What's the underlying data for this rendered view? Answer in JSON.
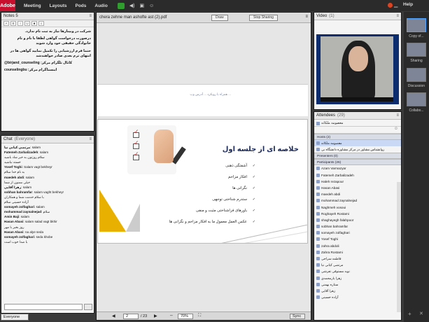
{
  "app": {
    "logo_text": "Adobe",
    "menus": [
      "Meeting",
      "Layouts",
      "Pods",
      "Audio"
    ],
    "help": "Help"
  },
  "notes": {
    "title": "Notes 5",
    "paragraphs": [
      "شرکت در وبینارها نیاز به ثبت نام ندارد.",
      "درصورت درخواست گواهی لطفا با نام و نام خانوادگی حقیقی خود وارد شوید",
      "حتما فرم ارزشیابی را تکمیل نمایید گواهی ها در انتهای ترم بعدی صادر خواهندشد",
      "@birjand_counseling :کانال تلگرام مرکز",
      "counselingbu :اینستاگرام مرکز"
    ]
  },
  "chat": {
    "title": "Chat",
    "audience": "(Everyone)",
    "tab": "Everyone",
    "messages": [
      {
        "name": "مرتضی کیانی نیا",
        "text": "salam"
      },
      {
        "name": "Fatemeh Zarbalizadeh",
        "text": "salam"
      },
      {
        "name": "",
        "text": "سلام روزتون به خیر شاد باشید"
      },
      {
        "name": "",
        "text": "خسته نباشید"
      },
      {
        "name": "Yosef Toghi",
        "text": "Salam vagt bekheyr"
      },
      {
        "name": "",
        "text": "به نام خدا سلام"
      },
      {
        "name": "maedeh abdi",
        "text": "salam"
      },
      {
        "name": "",
        "text": "خیلی ممنون از شما"
      },
      {
        "name": "زهرا آقایی",
        "text": "salam"
      },
      {
        "name": "sobhan bahramfar",
        "text": "salam vaght bekheyr"
      },
      {
        "name": "",
        "text": "با سلام خدمت شما و همکاران"
      },
      {
        "name": "",
        "text": "آزاده حسینی سلام"
      },
      {
        "name": "somayeh zolfaghari",
        "text": "salam"
      },
      {
        "name": "mohammad zaynalnejad",
        "text": "سلام"
      },
      {
        "name": "Amin Baji",
        "text": "salam"
      },
      {
        "name": "Hasan Abasi",
        "text": "salam salad vagt bkhir"
      },
      {
        "name": "",
        "text": "روز بخیر با مهر"
      },
      {
        "name": "Hasan Abasi",
        "text": "na alye seda"
      },
      {
        "name": "somayeh zolfaghari",
        "text": "seda khobe"
      },
      {
        "name": "",
        "text": "با صدا خوب است"
      }
    ]
  },
  "share": {
    "title": "chera zehne man ashofte ast (2).pdf",
    "draw_btn": "Draw",
    "stop_btn": "Stop Sharing",
    "top_slide_text": "... همراه با رویکرد ... آدرس وب",
    "slide": {
      "title": "خلاصه ای از جلسه اول",
      "bullets": [
        "آشفتگی ذهنی",
        "افکار مزاحم",
        "نگرانی ها",
        "ستدرم شناختی توجهی",
        "باورهای فراشناختی مثبت و منفی",
        "عکس العمل معمول ما به افکار مزاحم و نگرانی ها"
      ]
    },
    "page_current": "2",
    "page_total": "/ 23",
    "zoom": "70%",
    "sync": "Sync"
  },
  "video": {
    "title": "Video",
    "count": "(1)"
  },
  "attendees": {
    "title": "Attendees",
    "count": "(29)",
    "host_self": "معصومه ملکانه",
    "hosts_label": "Hosts (2)",
    "hosts": [
      "معصومه ملکانه",
      "روانشناس مشاور در مرکز مشاوره دانشگاه بی"
    ],
    "presenters_label": "Presenters (0)",
    "participants_label": "Participants (26)",
    "participants": [
      "Azam Varmazyar",
      "Fatemeh Zarbalizadeh",
      "Haleh rezapour",
      "Hasan Abasi",
      "maedeh abdi",
      "mohammad zaynalnejad",
      "Naghmeh vosoui",
      "Roghayeh Rostami",
      "shaghayegh falahpoor",
      "sobhan bahramfar",
      "somayeh zolfaghari",
      "Yosef Toghi",
      "zahra abdoli",
      "Zahra Rostami",
      "فاطمه سراجی",
      "مرتضی کیانی نیا",
      "نوید مستوفی تفرشی",
      "زهرا یارمحمدی",
      "ستاره بهمنی",
      "زهرا آقایی",
      "آزاده حسینی"
    ]
  },
  "rail": {
    "items": [
      "Copy of...",
      "Sharing",
      "Discussion",
      "Collabo..."
    ]
  }
}
